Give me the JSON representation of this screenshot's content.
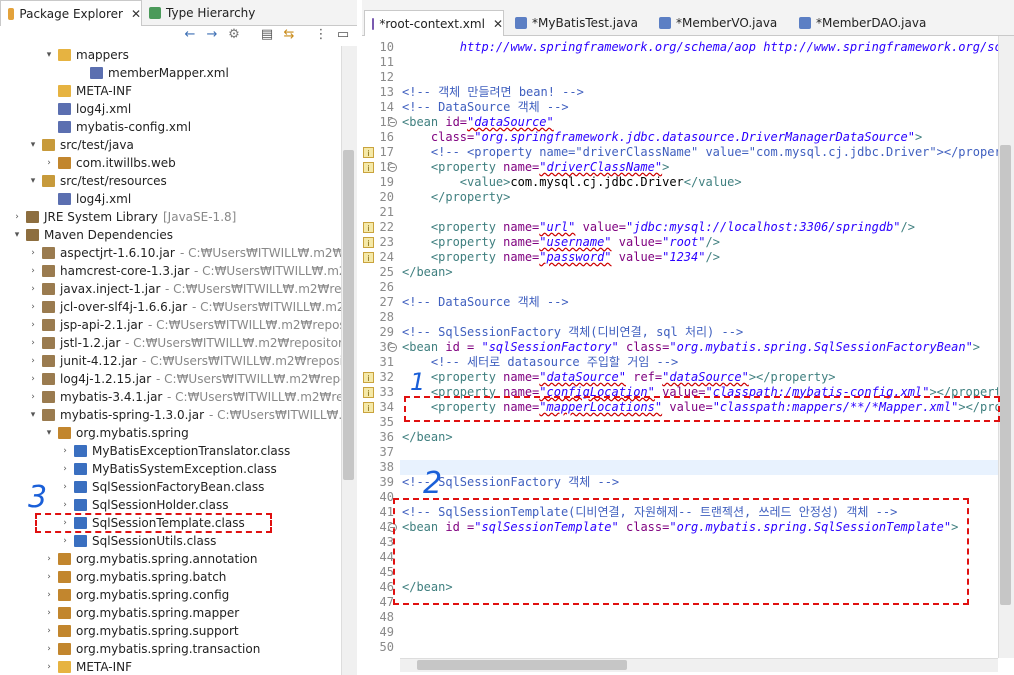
{
  "left_tabs": [
    {
      "label": "Package Explorer",
      "close": "✕",
      "active": true
    },
    {
      "label": "Type Hierarchy",
      "active": false
    }
  ],
  "tree": [
    {
      "indent": 3,
      "arrow": "▾",
      "icon": "folder",
      "label": "mappers"
    },
    {
      "indent": 5,
      "arrow": "",
      "icon": "xml",
      "label": "memberMapper.xml"
    },
    {
      "indent": 3,
      "arrow": "",
      "icon": "folder",
      "label": "META-INF"
    },
    {
      "indent": 3,
      "arrow": "",
      "icon": "xml",
      "label": "log4j.xml"
    },
    {
      "indent": 3,
      "arrow": "",
      "icon": "xml",
      "label": "mybatis-config.xml"
    },
    {
      "indent": 2,
      "arrow": "▾",
      "icon": "srcfolder",
      "label": "src/test/java"
    },
    {
      "indent": 3,
      "arrow": "›",
      "icon": "package",
      "label": "com.itwillbs.web"
    },
    {
      "indent": 2,
      "arrow": "▾",
      "icon": "srcfolder",
      "label": "src/test/resources"
    },
    {
      "indent": 3,
      "arrow": "",
      "icon": "xml",
      "label": "log4j.xml"
    },
    {
      "indent": 1,
      "arrow": "›",
      "icon": "library",
      "label": "JRE System Library",
      "extra": "[JavaSE-1.8]"
    },
    {
      "indent": 1,
      "arrow": "▾",
      "icon": "library",
      "label": "Maven Dependencies"
    },
    {
      "indent": 2,
      "arrow": "›",
      "icon": "jar",
      "label": "aspectjrt-1.6.10.jar",
      "extra": "- C:₩Users₩ITWILL₩.m2₩repo"
    },
    {
      "indent": 2,
      "arrow": "›",
      "icon": "jar",
      "label": "hamcrest-core-1.3.jar",
      "extra": "- C:₩Users₩ITWILL₩.m2₩re"
    },
    {
      "indent": 2,
      "arrow": "›",
      "icon": "jar",
      "label": "javax.inject-1.jar",
      "extra": "- C:₩Users₩ITWILL₩.m2₩reposit"
    },
    {
      "indent": 2,
      "arrow": "›",
      "icon": "jar",
      "label": "jcl-over-slf4j-1.6.6.jar",
      "extra": "- C:₩Users₩ITWILL₩.m2₩re"
    },
    {
      "indent": 2,
      "arrow": "›",
      "icon": "jar",
      "label": "jsp-api-2.1.jar",
      "extra": "- C:₩Users₩ITWILL₩.m2₩repositor"
    },
    {
      "indent": 2,
      "arrow": "›",
      "icon": "jar",
      "label": "jstl-1.2.jar",
      "extra": "- C:₩Users₩ITWILL₩.m2₩repository₩ja"
    },
    {
      "indent": 2,
      "arrow": "›",
      "icon": "jar",
      "label": "junit-4.12.jar",
      "extra": "- C:₩Users₩ITWILL₩.m2₩repository"
    },
    {
      "indent": 2,
      "arrow": "›",
      "icon": "jar",
      "label": "log4j-1.2.15.jar",
      "extra": "- C:₩Users₩ITWILL₩.m2₩reposito"
    },
    {
      "indent": 2,
      "arrow": "›",
      "icon": "jar",
      "label": "mybatis-3.4.1.jar",
      "extra": "- C:₩Users₩ITWILL₩.m2₩reposi"
    },
    {
      "indent": 2,
      "arrow": "▾",
      "icon": "jar",
      "label": "mybatis-spring-1.3.0.jar",
      "extra": "- C:₩Users₩ITWILL₩.m2₩r"
    },
    {
      "indent": 3,
      "arrow": "▾",
      "icon": "package",
      "label": "org.mybatis.spring"
    },
    {
      "indent": 4,
      "arrow": "›",
      "icon": "class",
      "label": "MyBatisExceptionTranslator.class"
    },
    {
      "indent": 4,
      "arrow": "›",
      "icon": "class",
      "label": "MyBatisSystemException.class"
    },
    {
      "indent": 4,
      "arrow": "›",
      "icon": "class",
      "label": "SqlSessionFactoryBean.class"
    },
    {
      "indent": 4,
      "arrow": "›",
      "icon": "class",
      "label": "SqlSessionHolder.class"
    },
    {
      "indent": 4,
      "arrow": "›",
      "icon": "class",
      "label": "SqlSessionTemplate.class"
    },
    {
      "indent": 4,
      "arrow": "›",
      "icon": "class",
      "label": "SqlSessionUtils.class"
    },
    {
      "indent": 3,
      "arrow": "›",
      "icon": "package",
      "label": "org.mybatis.spring.annotation"
    },
    {
      "indent": 3,
      "arrow": "›",
      "icon": "package",
      "label": "org.mybatis.spring.batch"
    },
    {
      "indent": 3,
      "arrow": "›",
      "icon": "package",
      "label": "org.mybatis.spring.config"
    },
    {
      "indent": 3,
      "arrow": "›",
      "icon": "package",
      "label": "org.mybatis.spring.mapper"
    },
    {
      "indent": 3,
      "arrow": "›",
      "icon": "package",
      "label": "org.mybatis.spring.support"
    },
    {
      "indent": 3,
      "arrow": "›",
      "icon": "package",
      "label": "org.mybatis.spring.transaction"
    },
    {
      "indent": 3,
      "arrow": "›",
      "icon": "folder",
      "label": "META-INF"
    }
  ],
  "editor_tabs": [
    {
      "label": "*root-context.xml",
      "icon": "xml",
      "close": "✕",
      "active": true
    },
    {
      "label": "*MyBatisTest.java",
      "icon": "java",
      "active": false
    },
    {
      "label": "*MemberVO.java",
      "icon": "java",
      "active": false
    },
    {
      "label": "*MemberDAO.java",
      "icon": "java",
      "active": false
    }
  ],
  "code_lines": [
    {
      "n": "10",
      "toks": [
        [
          "x",
          "        "
        ],
        [
          "v",
          "http://www.springframework.org/schema/aop http://www.springframework.org/sche"
        ]
      ]
    },
    {
      "n": "11",
      "toks": []
    },
    {
      "n": "12",
      "toks": []
    },
    {
      "n": "13",
      "toks": [
        [
          "c",
          "<!-- 객체 만들려면 bean! -->"
        ]
      ]
    },
    {
      "n": "14",
      "toks": [
        [
          "c",
          "<!-- DataSource 객체 -->"
        ]
      ]
    },
    {
      "n": "15",
      "fold": true,
      "toks": [
        [
          "t",
          "<bean "
        ],
        [
          "a",
          "id="
        ],
        [
          "v",
          "\"dataSource\""
        ]
      ]
    },
    {
      "n": "16",
      "toks": [
        [
          "x",
          "    "
        ],
        [
          "a",
          "class="
        ],
        [
          "v",
          "\"org.springframework.jdbc.datasource.DriverManagerDataSource\""
        ],
        [
          "t",
          ">"
        ]
      ]
    },
    {
      "n": "17",
      "mark": true,
      "toks": [
        [
          "x",
          "    "
        ],
        [
          "c",
          "<!-- <property name=\"driverClassName\" value=\"com.mysql.cj.jdbc.Driver\"></property"
        ]
      ]
    },
    {
      "n": "18",
      "mark": true,
      "fold": true,
      "toks": [
        [
          "x",
          "    "
        ],
        [
          "t",
          "<property "
        ],
        [
          "a",
          "name="
        ],
        [
          "v",
          "\"driverClassName\""
        ],
        [
          "t",
          ">"
        ]
      ]
    },
    {
      "n": "19",
      "toks": [
        [
          "x",
          "        "
        ],
        [
          "t",
          "<value>"
        ],
        [
          "x",
          "com.mysql.cj.jdbc.Driver"
        ],
        [
          "t",
          "</value>"
        ]
      ]
    },
    {
      "n": "20",
      "toks": [
        [
          "x",
          "    "
        ],
        [
          "t",
          "</property>"
        ]
      ]
    },
    {
      "n": "21",
      "toks": []
    },
    {
      "n": "22",
      "mark": true,
      "toks": [
        [
          "x",
          "    "
        ],
        [
          "t",
          "<property "
        ],
        [
          "a",
          "name="
        ],
        [
          "v",
          "\"url\""
        ],
        [
          "x",
          " "
        ],
        [
          "a",
          "value="
        ],
        [
          "v",
          "\"jdbc:mysql://localhost:3306/springdb\""
        ],
        [
          "t",
          "/>"
        ]
      ]
    },
    {
      "n": "23",
      "mark": true,
      "toks": [
        [
          "x",
          "    "
        ],
        [
          "t",
          "<property "
        ],
        [
          "a",
          "name="
        ],
        [
          "v",
          "\"username\""
        ],
        [
          "x",
          " "
        ],
        [
          "a",
          "value="
        ],
        [
          "v",
          "\"root\""
        ],
        [
          "t",
          "/>"
        ]
      ]
    },
    {
      "n": "24",
      "mark": true,
      "toks": [
        [
          "x",
          "    "
        ],
        [
          "t",
          "<property "
        ],
        [
          "a",
          "name="
        ],
        [
          "v",
          "\"password\""
        ],
        [
          "x",
          " "
        ],
        [
          "a",
          "value="
        ],
        [
          "v",
          "\"1234\""
        ],
        [
          "t",
          "/>"
        ]
      ]
    },
    {
      "n": "25",
      "toks": [
        [
          "t",
          "</bean>"
        ]
      ]
    },
    {
      "n": "26",
      "toks": []
    },
    {
      "n": "27",
      "toks": [
        [
          "c",
          "<!-- DataSource 객체 -->"
        ]
      ]
    },
    {
      "n": "28",
      "toks": []
    },
    {
      "n": "29",
      "toks": [
        [
          "c",
          "<!-- SqlSessionFactory 객체(디비연결, sql 처리) -->"
        ]
      ]
    },
    {
      "n": "30",
      "fold": true,
      "toks": [
        [
          "t",
          "<bean "
        ],
        [
          "a",
          "id = "
        ],
        [
          "v",
          "\"sqlSessionFactory\""
        ],
        [
          "x",
          " "
        ],
        [
          "a",
          "class="
        ],
        [
          "v",
          "\"org.mybatis.spring.SqlSessionFactoryBean\""
        ],
        [
          "t",
          ">"
        ]
      ]
    },
    {
      "n": "31",
      "toks": [
        [
          "x",
          "    "
        ],
        [
          "c",
          "<!-- 세터로 datasource 주입할 거임 -->"
        ]
      ]
    },
    {
      "n": "32",
      "mark": true,
      "toks": [
        [
          "x",
          "    "
        ],
        [
          "t",
          "<property "
        ],
        [
          "a",
          "name="
        ],
        [
          "v",
          "\"dataSource\""
        ],
        [
          "x",
          " "
        ],
        [
          "a",
          "ref="
        ],
        [
          "v",
          "\"dataSource\""
        ],
        [
          "t",
          "></property>"
        ]
      ]
    },
    {
      "n": "33",
      "mark": true,
      "toks": [
        [
          "x",
          "    "
        ],
        [
          "t",
          "<property "
        ],
        [
          "a",
          "name="
        ],
        [
          "v",
          "\"configLocation\""
        ],
        [
          "x",
          " "
        ],
        [
          "a",
          "value="
        ],
        [
          "v",
          "\"classpath:/mybatis-config.xml\""
        ],
        [
          "t",
          "></property>"
        ]
      ]
    },
    {
      "n": "34",
      "mark": true,
      "toks": [
        [
          "x",
          "    "
        ],
        [
          "t",
          "<property "
        ],
        [
          "a",
          "name="
        ],
        [
          "v",
          "\"mapperLocations\""
        ],
        [
          "x",
          " "
        ],
        [
          "a",
          "value="
        ],
        [
          "v",
          "\"classpath:mappers/**/*Mapper.xml\""
        ],
        [
          "t",
          "></prope"
        ]
      ]
    },
    {
      "n": "35",
      "toks": []
    },
    {
      "n": "36",
      "toks": [
        [
          "t",
          "</bean>"
        ]
      ]
    },
    {
      "n": "37",
      "toks": []
    },
    {
      "n": "38",
      "toks": [],
      "current": true
    },
    {
      "n": "39",
      "toks": [
        [
          "c",
          "<!-- SqlSessionFactory 객체 -->"
        ]
      ]
    },
    {
      "n": "40",
      "toks": []
    },
    {
      "n": "41",
      "toks": [
        [
          "c",
          "<!-- SqlSessionTemplate(디비연결, 자원해제-- 트랜젝션, 쓰레드 안정성) 객체 -->"
        ]
      ]
    },
    {
      "n": "42",
      "fold": true,
      "toks": [
        [
          "t",
          "<bean "
        ],
        [
          "a",
          "id ="
        ],
        [
          "v",
          "\"sqlSessionTemplate\""
        ],
        [
          "x",
          " "
        ],
        [
          "a",
          "class="
        ],
        [
          "v",
          "\"org.mybatis.spring.SqlSessionTemplate\""
        ],
        [
          "t",
          ">"
        ]
      ]
    },
    {
      "n": "43",
      "toks": []
    },
    {
      "n": "44",
      "toks": []
    },
    {
      "n": "45",
      "toks": []
    },
    {
      "n": "46",
      "toks": [
        [
          "t",
          "</bean>"
        ]
      ]
    },
    {
      "n": "47",
      "toks": []
    },
    {
      "n": "48",
      "toks": []
    },
    {
      "n": "49",
      "toks": []
    },
    {
      "n": "50",
      "toks": []
    }
  ],
  "annotations": {
    "one": "1",
    "two": "2",
    "three": "3"
  },
  "colors": {
    "annotation_box": "#e01010",
    "annotation_ink": "#1a5fd8",
    "tag": "#3f7f7f",
    "attr": "#7f007f",
    "value": "#2a00ff",
    "comment": "#3f5fbf"
  }
}
